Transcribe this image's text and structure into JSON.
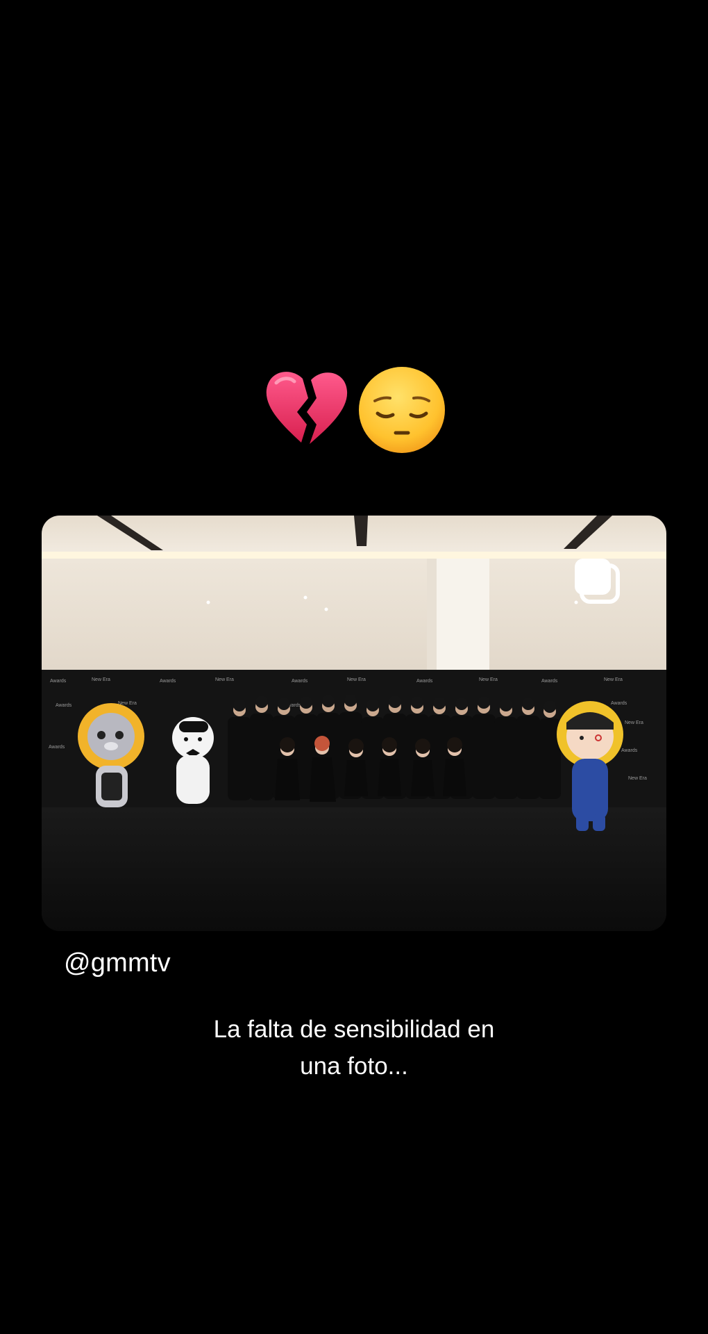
{
  "post": {
    "emojis": [
      "broken-heart-icon",
      "pensive-face-icon"
    ],
    "image": {
      "description_icon": "multiple-images-icon"
    },
    "handle": "@gmmtv",
    "caption_lines": [
      "La falta de sensibilidad en",
      "una foto..."
    ]
  },
  "colors": {
    "background": "#000000",
    "text": "#ffffff"
  }
}
